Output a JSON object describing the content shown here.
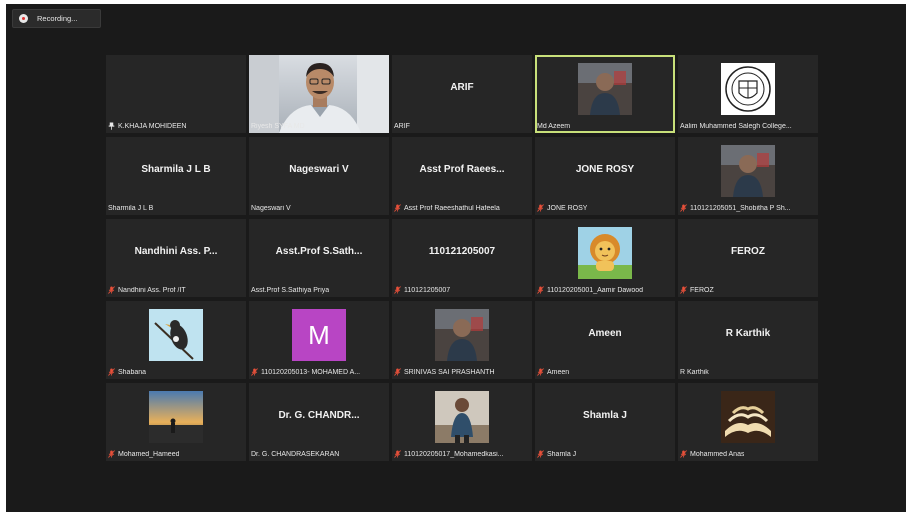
{
  "recording": {
    "label": "Recording..."
  },
  "colors": {
    "background": "#1a1a1a",
    "tile": "#262626",
    "active_border": "#c8e07a",
    "mic_muted": "#e8503a",
    "avatar_m": "#b845c4"
  },
  "tiles": [
    {
      "big": "",
      "label": "K.KHAJA MOHIDEEN",
      "icon": "pin-icon",
      "media": "empty"
    },
    {
      "big": "",
      "label": "Riyesh SYFA MD",
      "icon": "",
      "media": "webcam"
    },
    {
      "big": "ARIF",
      "label": "ARIF",
      "icon": "",
      "media": ""
    },
    {
      "big": "",
      "label": "Md Azeem",
      "icon": "",
      "media": "photo",
      "active": true
    },
    {
      "big": "",
      "label": "Aalim Muhammed Salegh College...",
      "icon": "",
      "media": "logo"
    },
    {
      "big": "Sharmila J L B",
      "label": "Sharmila J L B",
      "icon": "",
      "media": ""
    },
    {
      "big": "Nageswari V",
      "label": "Nageswari V",
      "icon": "",
      "media": ""
    },
    {
      "big": "Asst Prof Raees...",
      "label": "Asst Prof Raeeshathul Hafeela",
      "icon": "mic-muted-icon",
      "media": ""
    },
    {
      "big": "JONE ROSY",
      "label": "JONE ROSY",
      "icon": "mic-muted-icon",
      "media": ""
    },
    {
      "big": "",
      "label": "110121205051_Shobitha P Sh...",
      "icon": "mic-muted-icon",
      "media": "photo"
    },
    {
      "big": "Nandhini Ass. P...",
      "label": "Nandhini Ass. Prof /IT",
      "icon": "mic-muted-icon",
      "media": ""
    },
    {
      "big": "Asst.Prof S.Sath...",
      "label": "Asst.Prof S.Sathiya Priya",
      "icon": "",
      "media": ""
    },
    {
      "big": "110121205007",
      "label": "110121205007",
      "icon": "mic-muted-icon",
      "media": ""
    },
    {
      "big": "",
      "label": "110120205001_Aamir Dawood",
      "icon": "mic-muted-icon",
      "media": "lion"
    },
    {
      "big": "FEROZ",
      "label": "FEROZ",
      "icon": "mic-muted-icon",
      "media": ""
    },
    {
      "big": "",
      "label": "Shabana",
      "icon": "mic-muted-icon",
      "media": "bird"
    },
    {
      "big": "",
      "label": "110120205013- MOHAMED A...",
      "icon": "mic-muted-icon",
      "media": "avatar-m",
      "avatar_letter": "M"
    },
    {
      "big": "",
      "label": "SRINIVAS SAI PRASHANTH",
      "icon": "mic-muted-icon",
      "media": "photo"
    },
    {
      "big": "Ameen",
      "label": "Ameen",
      "icon": "mic-muted-icon",
      "media": ""
    },
    {
      "big": "R Karthik",
      "label": "R Karthik",
      "icon": "",
      "media": ""
    },
    {
      "big": "",
      "label": "Mohamed_Hameed",
      "icon": "mic-muted-icon",
      "media": "sunset"
    },
    {
      "big": "Dr. G. CHANDR...",
      "label": "Dr. G. CHANDRASEKARAN",
      "icon": "",
      "media": ""
    },
    {
      "big": "",
      "label": "110120205017_Mohamedkasi...",
      "icon": "mic-muted-icon",
      "media": "photo2"
    },
    {
      "big": "Shamla J",
      "label": "Shamla J",
      "icon": "mic-muted-icon",
      "media": ""
    },
    {
      "big": "",
      "label": "Mohammed Anas",
      "icon": "mic-muted-icon",
      "media": "book"
    }
  ]
}
